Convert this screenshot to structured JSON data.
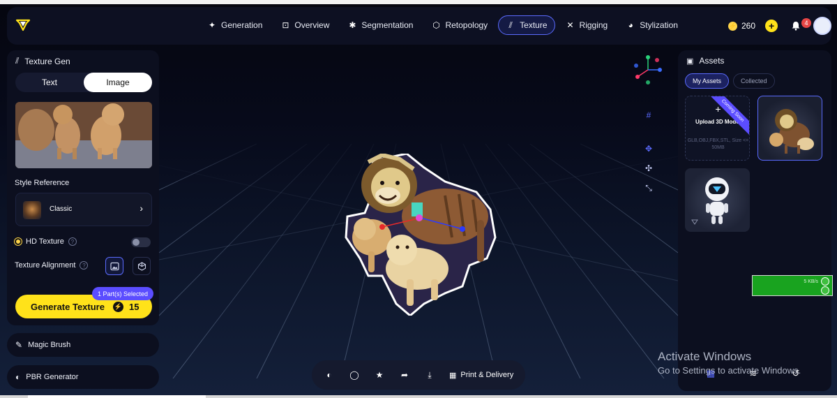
{
  "nav": {
    "tabs": [
      {
        "label": "Generation",
        "icon": "sparkle-icon",
        "glyph": "✦"
      },
      {
        "label": "Overview",
        "icon": "overview-icon",
        "glyph": "⊡"
      },
      {
        "label": "Segmentation",
        "icon": "puzzle-icon",
        "glyph": "✱"
      },
      {
        "label": "Retopology",
        "icon": "cube-mesh-icon",
        "glyph": "⬡"
      },
      {
        "label": "Texture",
        "icon": "texture-icon",
        "glyph": "⫽",
        "active": true
      },
      {
        "label": "Rigging",
        "icon": "rigging-figure-icon",
        "glyph": "✕"
      },
      {
        "label": "Stylization",
        "icon": "palette-icon",
        "glyph": "◕"
      }
    ],
    "credits": "260",
    "notifications": "4"
  },
  "left": {
    "title": "Texture Gen",
    "mode_text": "Text",
    "mode_image": "Image",
    "style_reference_label": "Style Reference",
    "style_name": "Classic",
    "hd_texture_label": "HD Texture",
    "texture_alignment_label": "Texture Alignment",
    "generate_label": "Generate Texture",
    "generate_cost": "15",
    "parts_selected": "1 Part(s) Selected",
    "magic_brush": "Magic Brush",
    "pbr_generator": "PBR Generator"
  },
  "bottombar": {
    "print_delivery": "Print & Delivery"
  },
  "assets": {
    "title": "Assets",
    "tab_my": "My Assets",
    "tab_collected": "Collected",
    "upload_label": "Upload 3D Model",
    "upload_formats": "GLB,OBJ,FBX,STL, Size <= 50MB",
    "coming_soon": "Coming Soon"
  },
  "overlay": {
    "greenbar_text": "5 KB/s",
    "activate_line1": "Activate Windows",
    "activate_line2": "Go to Settings to activate Windows."
  },
  "colors": {
    "accent": "#5b6bff",
    "cta": "#ffe21a",
    "badge": "#e64545"
  }
}
